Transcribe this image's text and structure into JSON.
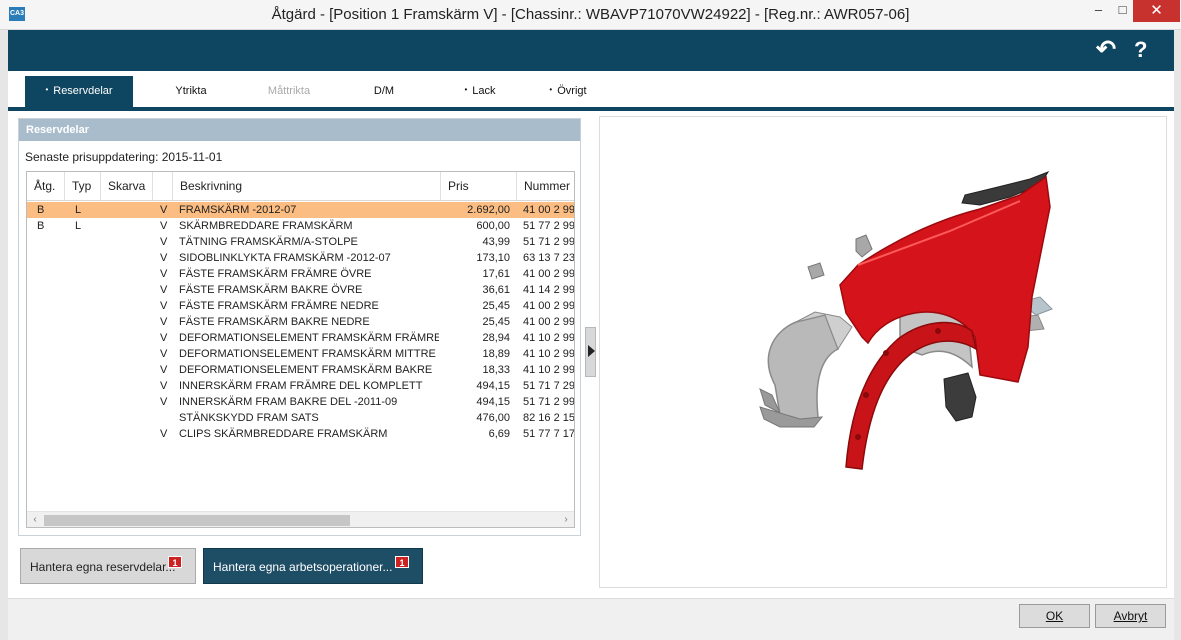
{
  "window": {
    "app_icon_text": "CA3",
    "title": "Åtgärd - [Position 1 Framskärm V] - [Chassinr.: WBAVP71070VW24922] -  [Reg.nr.: AWR057-06]",
    "min_glyph": "–",
    "max_glyph": "□",
    "close_glyph": "✕"
  },
  "header": {
    "undo_glyph": "↶",
    "help_glyph": "?"
  },
  "tabs": [
    {
      "label": "Reservdelar",
      "state": "active",
      "dot": "•"
    },
    {
      "label": "Ytrikta",
      "state": "normal",
      "dot": ""
    },
    {
      "label": "Måttrikta",
      "state": "disabled",
      "dot": ""
    },
    {
      "label": "D/M",
      "state": "normal",
      "dot": ""
    },
    {
      "label": "Lack",
      "state": "normal",
      "dot": "•"
    },
    {
      "label": "Övrigt",
      "state": "normal",
      "dot": "•"
    }
  ],
  "parts_panel": {
    "header": "Reservdelar",
    "price_update": "Senaste prisuppdatering: 2015-11-01",
    "columns": {
      "atg": "Åtg.",
      "typ": "Typ",
      "skarva": "Skarva",
      "v": "",
      "desc": "Beskrivning",
      "pris": "Pris",
      "num": "Nummer"
    },
    "rows": [
      {
        "atg": "B",
        "typ": "L",
        "v": "V",
        "desc": "FRAMSKÄRM -2012-07",
        "pris": "2.692,00",
        "num": "41 00 2 99",
        "selected": true
      },
      {
        "atg": "B",
        "typ": "L",
        "v": "V",
        "desc": "SKÄRMBREDDARE FRAMSKÄRM",
        "pris": "600,00",
        "num": "51 77 2 99",
        "selected": false
      },
      {
        "atg": "",
        "typ": "",
        "v": "V",
        "desc": "TÄTNING FRAMSKÄRM/A-STOLPE",
        "pris": "43,99",
        "num": "51 71 2 99",
        "selected": false
      },
      {
        "atg": "",
        "typ": "",
        "v": "V",
        "desc": "SIDOBLINKLYKTA FRAMSKÄRM -2012-07",
        "pris": "173,10",
        "num": "63 13 7 23",
        "selected": false
      },
      {
        "atg": "",
        "typ": "",
        "v": "V",
        "desc": "FÄSTE FRAMSKÄRM FRÄMRE ÖVRE",
        "pris": "17,61",
        "num": "41 00 2 99",
        "selected": false
      },
      {
        "atg": "",
        "typ": "",
        "v": "V",
        "desc": "FÄSTE FRAMSKÄRM BAKRE ÖVRE",
        "pris": "36,61",
        "num": "41 14 2 99",
        "selected": false
      },
      {
        "atg": "",
        "typ": "",
        "v": "V",
        "desc": "FÄSTE FRAMSKÄRM FRÄMRE NEDRE",
        "pris": "25,45",
        "num": "41 00 2 99",
        "selected": false
      },
      {
        "atg": "",
        "typ": "",
        "v": "V",
        "desc": "FÄSTE FRAMSKÄRM BAKRE NEDRE",
        "pris": "25,45",
        "num": "41 00 2 99",
        "selected": false
      },
      {
        "atg": "",
        "typ": "",
        "v": "V",
        "desc": "DEFORMATIONSELEMENT FRAMSKÄRM FRÄMRE",
        "pris": "28,94",
        "num": "41 10 2 99",
        "selected": false
      },
      {
        "atg": "",
        "typ": "",
        "v": "V",
        "desc": "DEFORMATIONSELEMENT FRAMSKÄRM MITTRE",
        "pris": "18,89",
        "num": "41 10 2 99",
        "selected": false
      },
      {
        "atg": "",
        "typ": "",
        "v": "V",
        "desc": "DEFORMATIONSELEMENT FRAMSKÄRM BAKRE",
        "pris": "18,33",
        "num": "41 10 2 99",
        "selected": false
      },
      {
        "atg": "",
        "typ": "",
        "v": "V",
        "desc": "INNERSKÄRM FRAM FRÄMRE DEL KOMPLETT",
        "pris": "494,15",
        "num": "51 71 7 29",
        "selected": false
      },
      {
        "atg": "",
        "typ": "",
        "v": "V",
        "desc": "INNERSKÄRM FRAM BAKRE DEL -2011-09",
        "pris": "494,15",
        "num": "51 71 2 99",
        "selected": false
      },
      {
        "atg": "",
        "typ": "",
        "v": "",
        "desc": "STÄNKSKYDD FRAM SATS",
        "pris": "476,00",
        "num": "82 16 2 15",
        "selected": false
      },
      {
        "atg": "",
        "typ": "",
        "v": "V",
        "desc": "CLIPS SKÄRMBREDDARE FRAMSKÄRM",
        "pris": "6,69",
        "num": "51 77 7 17",
        "selected": false
      }
    ],
    "scroll_left": "‹",
    "scroll_right": "›"
  },
  "buttons": {
    "manage_parts": "Hantera egna reservdelar...",
    "manage_parts_badge": "1",
    "manage_ops": "Hantera egna arbetsoperationer...",
    "manage_ops_badge": "1"
  },
  "footer": {
    "ok": "OK",
    "cancel": "Avbryt"
  },
  "colors": {
    "accent": "#0e4560",
    "selected_row": "#fbbd82",
    "fender_red": "#d4141a"
  }
}
